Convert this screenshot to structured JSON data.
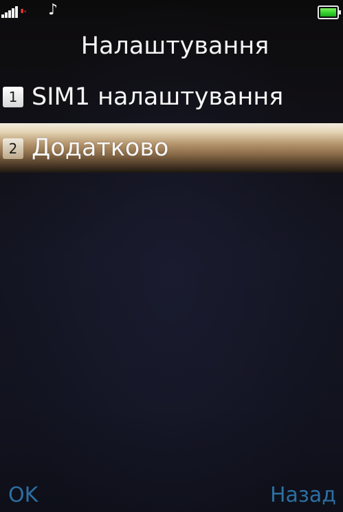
{
  "status_bar": {
    "signal_icon": "signal-bars-icon",
    "sim_icon": "sim-missing-icon",
    "sim_icon_text": "ₓ",
    "profile_icon": "music-note-icon",
    "profile_icon_glyph": "♪",
    "battery_icon": "battery-full-icon",
    "battery_level": 1.0,
    "battery_color": "#2fcf2a"
  },
  "header": {
    "title": "Налаштування"
  },
  "menu": {
    "items": [
      {
        "number": "1",
        "label": "SIM1  налаштування",
        "selected": false
      },
      {
        "number": "2",
        "label": "Додатково",
        "selected": true
      }
    ]
  },
  "softkeys": {
    "left": "OK",
    "right": "Назад",
    "color": "#2c6fa3"
  },
  "colors": {
    "text": "#f4f4f4",
    "highlight_top": "#f2ecdf",
    "highlight_bottom": "#1d1712",
    "background": "#12131f"
  }
}
